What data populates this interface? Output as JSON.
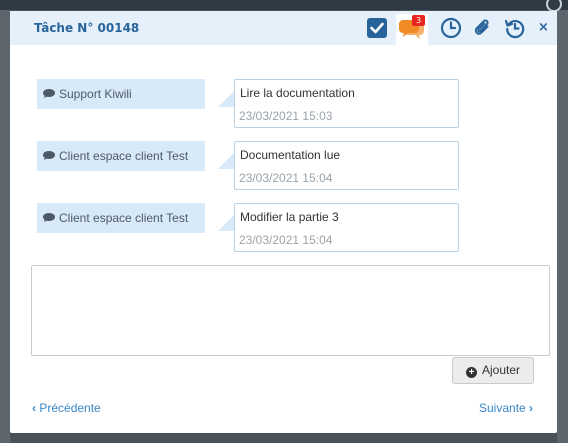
{
  "modal": {
    "title": "Tâche N° 00148",
    "header_icons": [
      {
        "name": "checkbox-icon"
      },
      {
        "name": "comments-icon",
        "badge": "3"
      },
      {
        "name": "clock-icon"
      },
      {
        "name": "paperclip-icon"
      },
      {
        "name": "history-icon"
      }
    ],
    "close_label": "×"
  },
  "messages": [
    {
      "author": "Support Kiwili",
      "text": "Lire la documentation",
      "time": "23/03/2021 15:03"
    },
    {
      "author": "Client espace client Test",
      "text": "Documentation lue",
      "time": "23/03/2021 15:04"
    },
    {
      "author": "Client espace client Test",
      "text": "Modifier la partie 3",
      "time": "23/03/2021 15:04"
    }
  ],
  "comment": {
    "value": "",
    "placeholder": ""
  },
  "actions": {
    "add_label": "Ajouter"
  },
  "navigation": {
    "previous_label": "Précédente",
    "next_label": "Suivante"
  },
  "colors": {
    "accent": "#28639a",
    "link": "#3a87c8",
    "badge": "#e8261f",
    "comment_icon": "#f08a24",
    "author_bg": "#d8eaf9"
  }
}
